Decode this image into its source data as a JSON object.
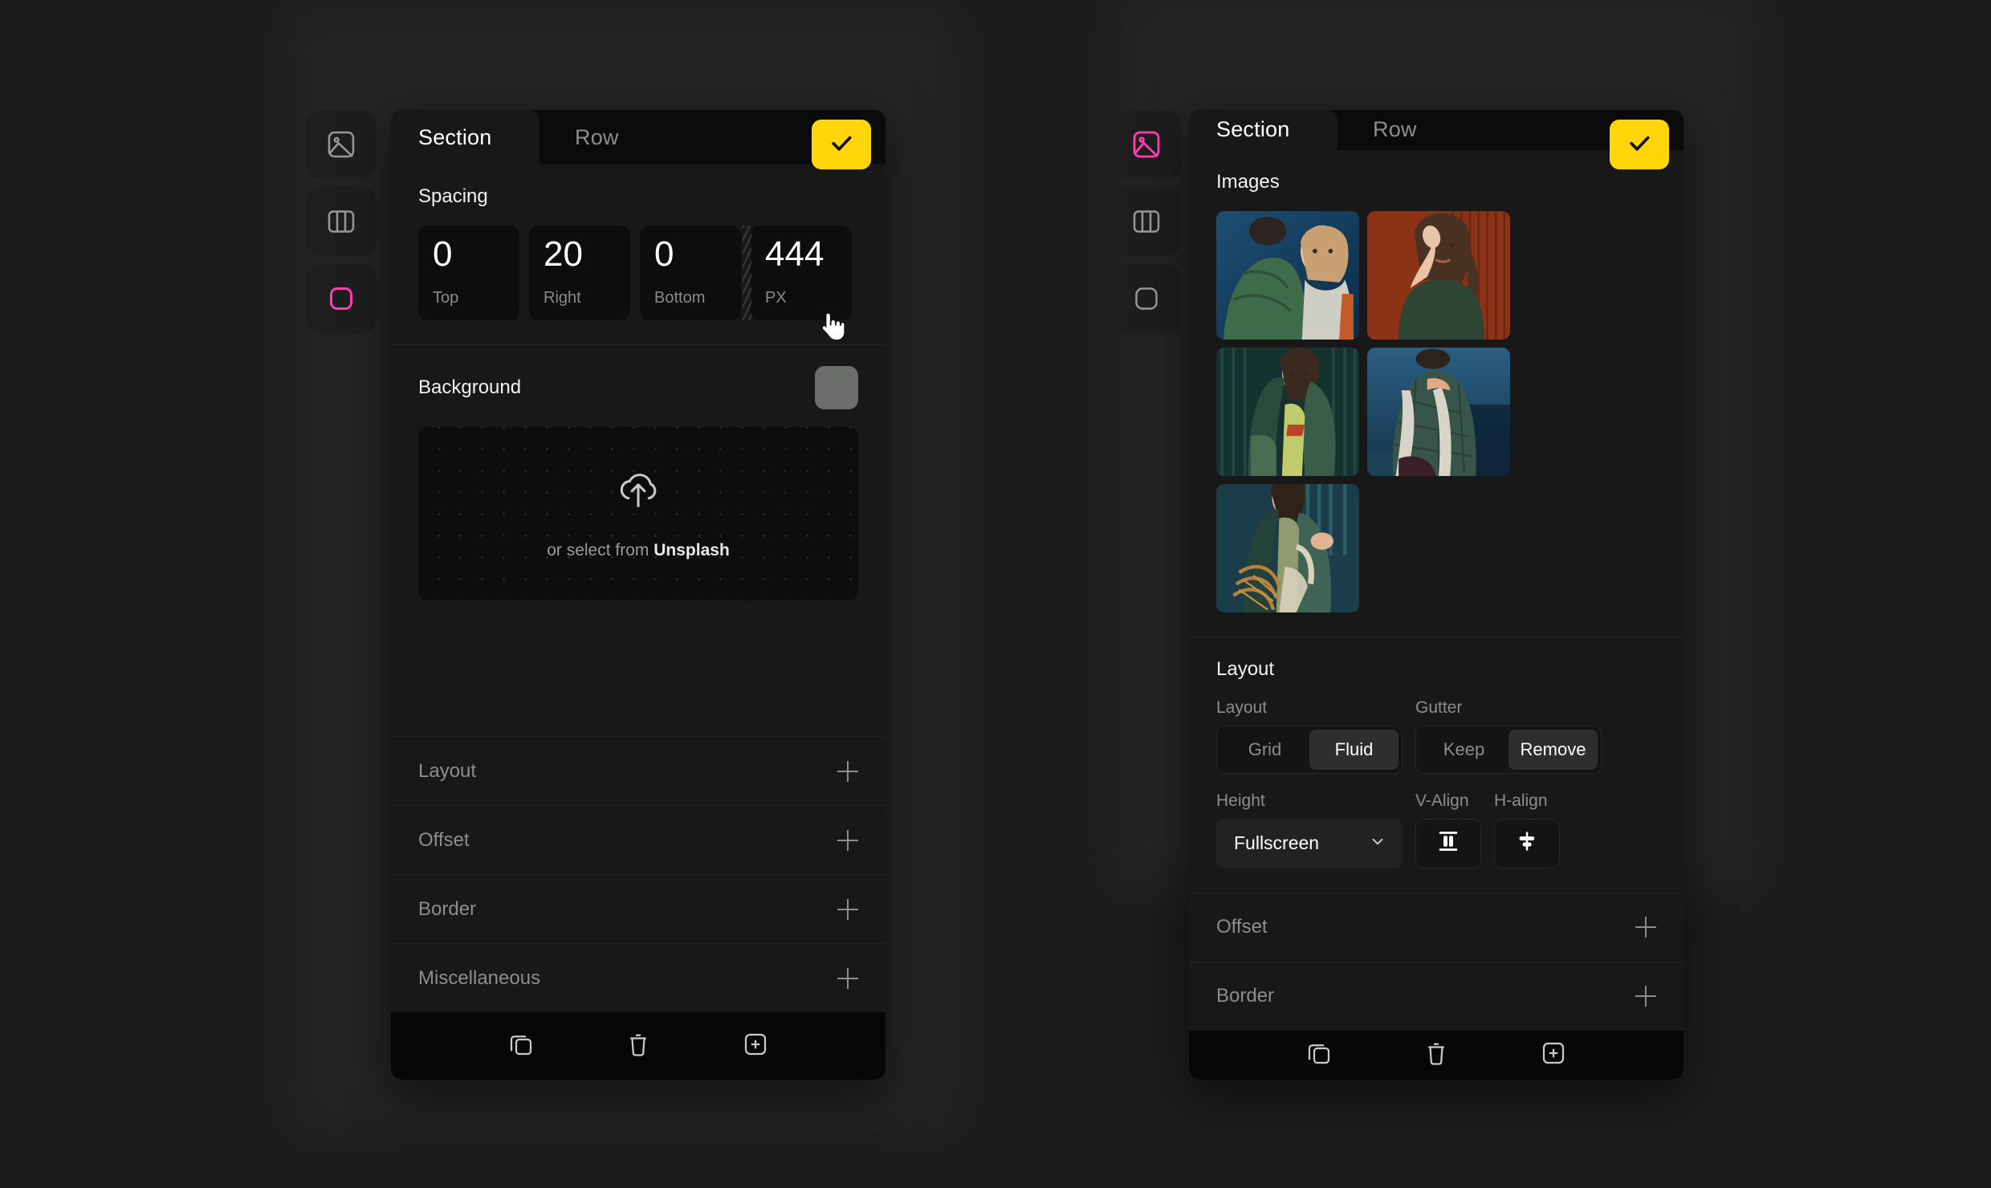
{
  "accent": {
    "yellow": "#ffd60a",
    "pink": "#ff3fb4",
    "swatch_gray": "#6b6e6b"
  },
  "left_panel": {
    "rail": [
      {
        "icon": "image-icon",
        "active": false
      },
      {
        "icon": "columns-icon",
        "active": false
      },
      {
        "icon": "rounded-square-icon",
        "active": true
      }
    ],
    "tabs": {
      "active_label": "Section",
      "idle_label": "Row"
    },
    "confirm_icon": "check-icon",
    "spacing": {
      "title": "Spacing",
      "fields": [
        {
          "value": "0",
          "label": "Top"
        },
        {
          "value": "20",
          "label": "Right"
        },
        {
          "value": "0",
          "label": "Bottom"
        },
        {
          "value": "444",
          "label": "PX"
        }
      ]
    },
    "background": {
      "title": "Background",
      "swatch_color": "#6b6e6b",
      "upload_icon": "cloud-upload-icon",
      "caption_prefix": "or select from ",
      "caption_link": "Unsplash"
    },
    "accordions": [
      "Layout",
      "Offset",
      "Border",
      "Miscellaneous"
    ],
    "footer_icons": [
      "duplicate-icon",
      "trash-icon",
      "add-square-icon"
    ]
  },
  "right_panel": {
    "rail": [
      {
        "icon": "image-icon",
        "active": true
      },
      {
        "icon": "columns-icon",
        "active": false
      },
      {
        "icon": "rounded-square-icon",
        "active": false
      }
    ],
    "tabs": {
      "active_label": "Section",
      "idle_label": "Row"
    },
    "confirm_icon": "check-icon",
    "images": {
      "title": "Images",
      "items": [
        {
          "alt": "two people in green puffer jackets on blue background"
        },
        {
          "alt": "woman with hand near face on orange backdrop"
        },
        {
          "alt": "woman wrapped in green coat by teal curtain"
        },
        {
          "alt": "green quilted coat with white belt on blue backdrop"
        },
        {
          "alt": "woman in green coat leaning on rattan chair"
        }
      ]
    },
    "layout": {
      "title": "Layout",
      "layout_label": "Layout",
      "layout_options": [
        "Grid",
        "Fluid"
      ],
      "layout_selected": "Fluid",
      "gutter_label": "Gutter",
      "gutter_options": [
        "Keep",
        "Remove"
      ],
      "gutter_selected": "Remove",
      "height_label": "Height",
      "height_value": "Fullscreen",
      "valign_label": "V-Align",
      "valign_icon": "align-vertical-stretch-icon",
      "halign_label": "H-align",
      "halign_icon": "align-horizontal-center-icon"
    },
    "accordions": [
      "Offset",
      "Border"
    ],
    "footer_icons": [
      "duplicate-icon",
      "trash-icon",
      "add-square-icon"
    ]
  }
}
